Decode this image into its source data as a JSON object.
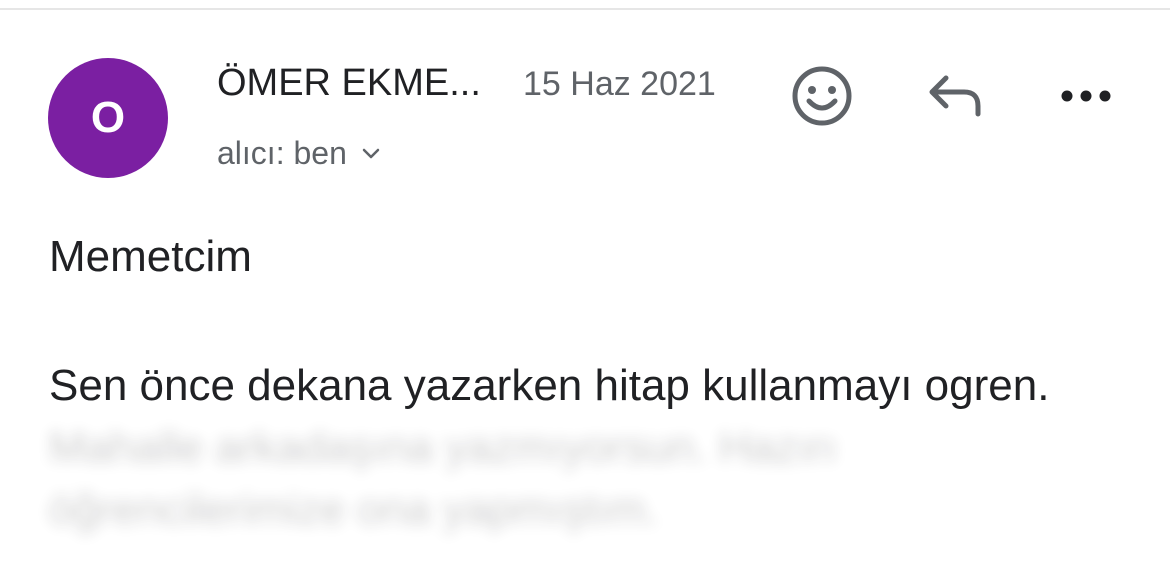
{
  "message": {
    "avatar_letter": "O",
    "avatar_color": "#7b1fa2",
    "sender": "ÖMER EKME...",
    "date": "15 Haz 2021",
    "recipient": "alıcı: ben",
    "greeting": "Memetcim",
    "body_visible": "Sen önce dekana yazarken hitap kullanmayı ogren.",
    "body_obscured": "Mahalle arkadaşına yazmıyorsun. Hazırı öğrencilerimize ona yapmıştım."
  },
  "icons": {
    "emoji": "smiley-icon",
    "reply": "reply-icon",
    "more": "more-horizontal-icon",
    "recipient_toggle": "chevron-down-icon"
  }
}
